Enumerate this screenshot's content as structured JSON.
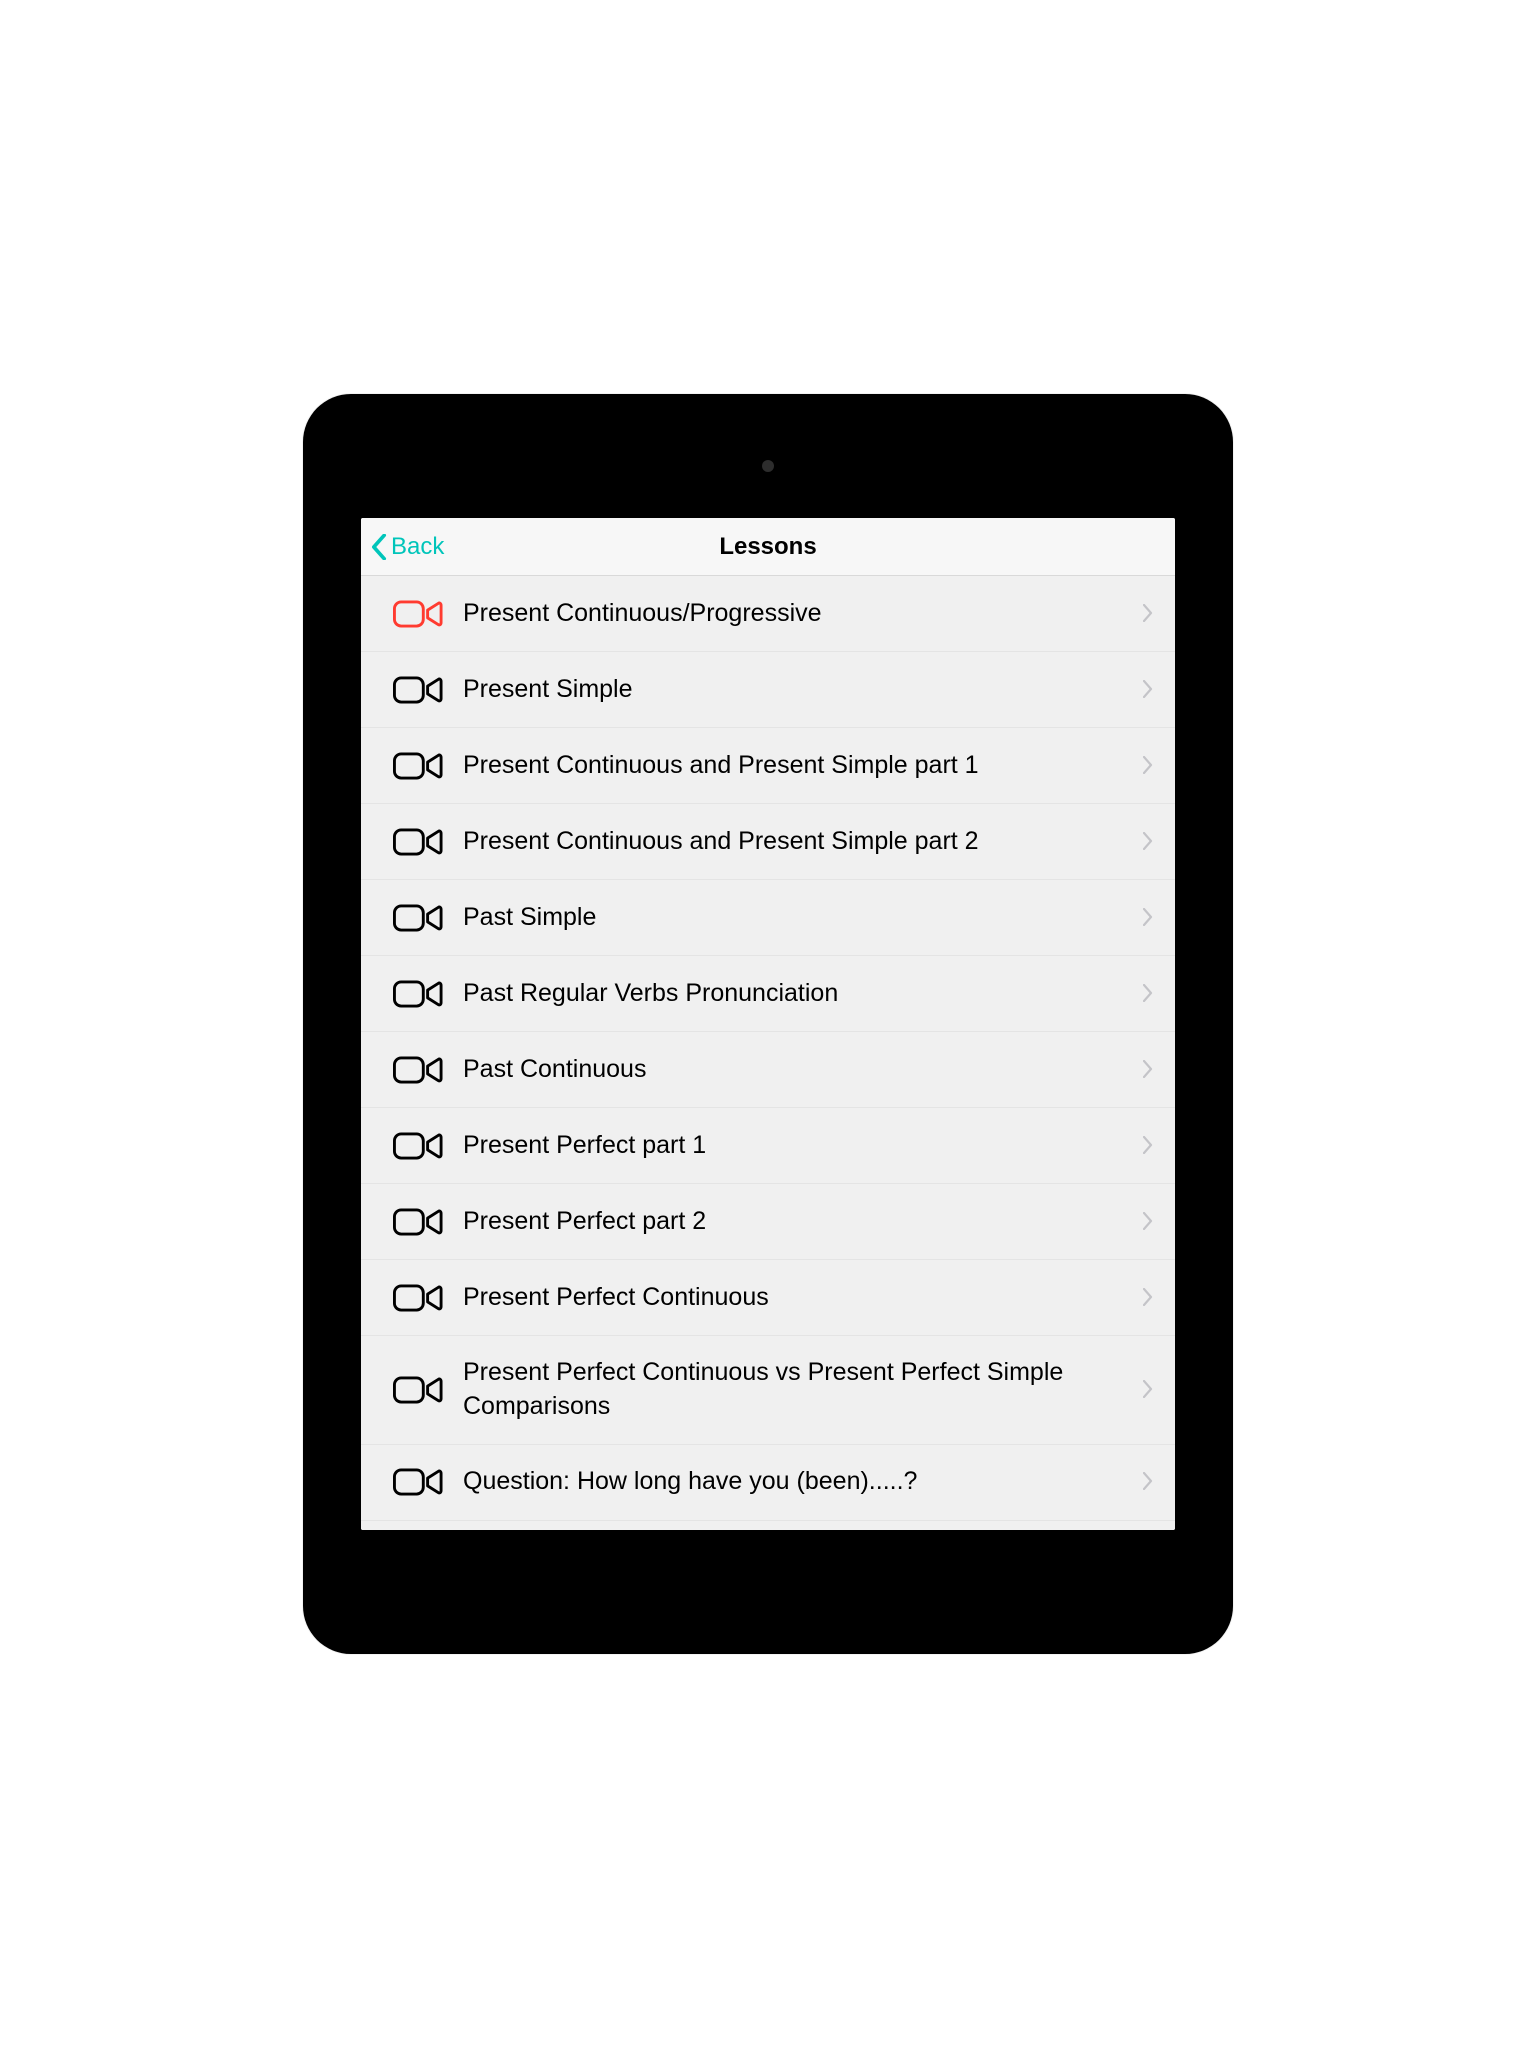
{
  "nav": {
    "back_label": "Back",
    "title": "Lessons"
  },
  "colors": {
    "accent_back": "#00c5ba",
    "icon_active": "#ff3b30",
    "icon_default": "#000000",
    "chevron": "#c7c7cc"
  },
  "lessons": [
    {
      "label": "Present Continuous/Progressive",
      "active": true
    },
    {
      "label": "Present Simple",
      "active": false
    },
    {
      "label": "Present Continuous and Present Simple part 1",
      "active": false
    },
    {
      "label": "Present Continuous and Present Simple part 2",
      "active": false
    },
    {
      "label": "Past Simple",
      "active": false
    },
    {
      "label": "Past Regular Verbs Pronunciation",
      "active": false
    },
    {
      "label": "Past Continuous",
      "active": false
    },
    {
      "label": "Present Perfect part 1",
      "active": false
    },
    {
      "label": "Present Perfect part 2",
      "active": false
    },
    {
      "label": "Present Perfect Continuous",
      "active": false
    },
    {
      "label": "Present Perfect Continuous vs Present Perfect Simple Comparisons",
      "active": false
    },
    {
      "label": "Question: How long have you (been).....?",
      "active": false
    }
  ]
}
